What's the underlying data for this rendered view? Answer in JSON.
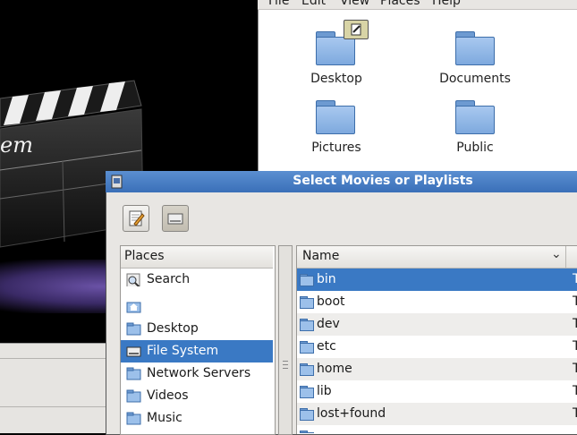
{
  "file_manager": {
    "menu": [
      "File",
      "Edit",
      "View",
      "Places",
      "Help"
    ],
    "icons": [
      {
        "label": "Desktop",
        "icon": "folder-icon"
      },
      {
        "label": "Documents",
        "icon": "folder-icon"
      },
      {
        "label": "Pictures",
        "icon": "folder-icon"
      },
      {
        "label": "Public",
        "icon": "folder-icon"
      }
    ]
  },
  "player": {
    "clapper_text": "em"
  },
  "dialog": {
    "title": "Select Movies or Playlists",
    "places_header": "Places",
    "places": [
      {
        "label": "Search",
        "icon": "search-icon"
      },
      {
        "label": "",
        "icon": "home-icon"
      },
      {
        "label": "Desktop",
        "icon": "desktop-icon"
      },
      {
        "label": "File System",
        "icon": "drive-icon",
        "selected": true
      },
      {
        "label": "Network Servers",
        "icon": "network-icon"
      },
      {
        "label": "Videos",
        "icon": "folder-icon"
      },
      {
        "label": "Music",
        "icon": "folder-icon"
      }
    ],
    "name_header": "Name",
    "files": [
      {
        "name": "bin",
        "type": "T",
        "selected": true
      },
      {
        "name": "boot",
        "type": "T"
      },
      {
        "name": "dev",
        "type": "T"
      },
      {
        "name": "etc",
        "type": "T"
      },
      {
        "name": "home",
        "type": "T"
      },
      {
        "name": "lib",
        "type": "T"
      },
      {
        "name": "lost+found",
        "type": "T"
      }
    ]
  }
}
